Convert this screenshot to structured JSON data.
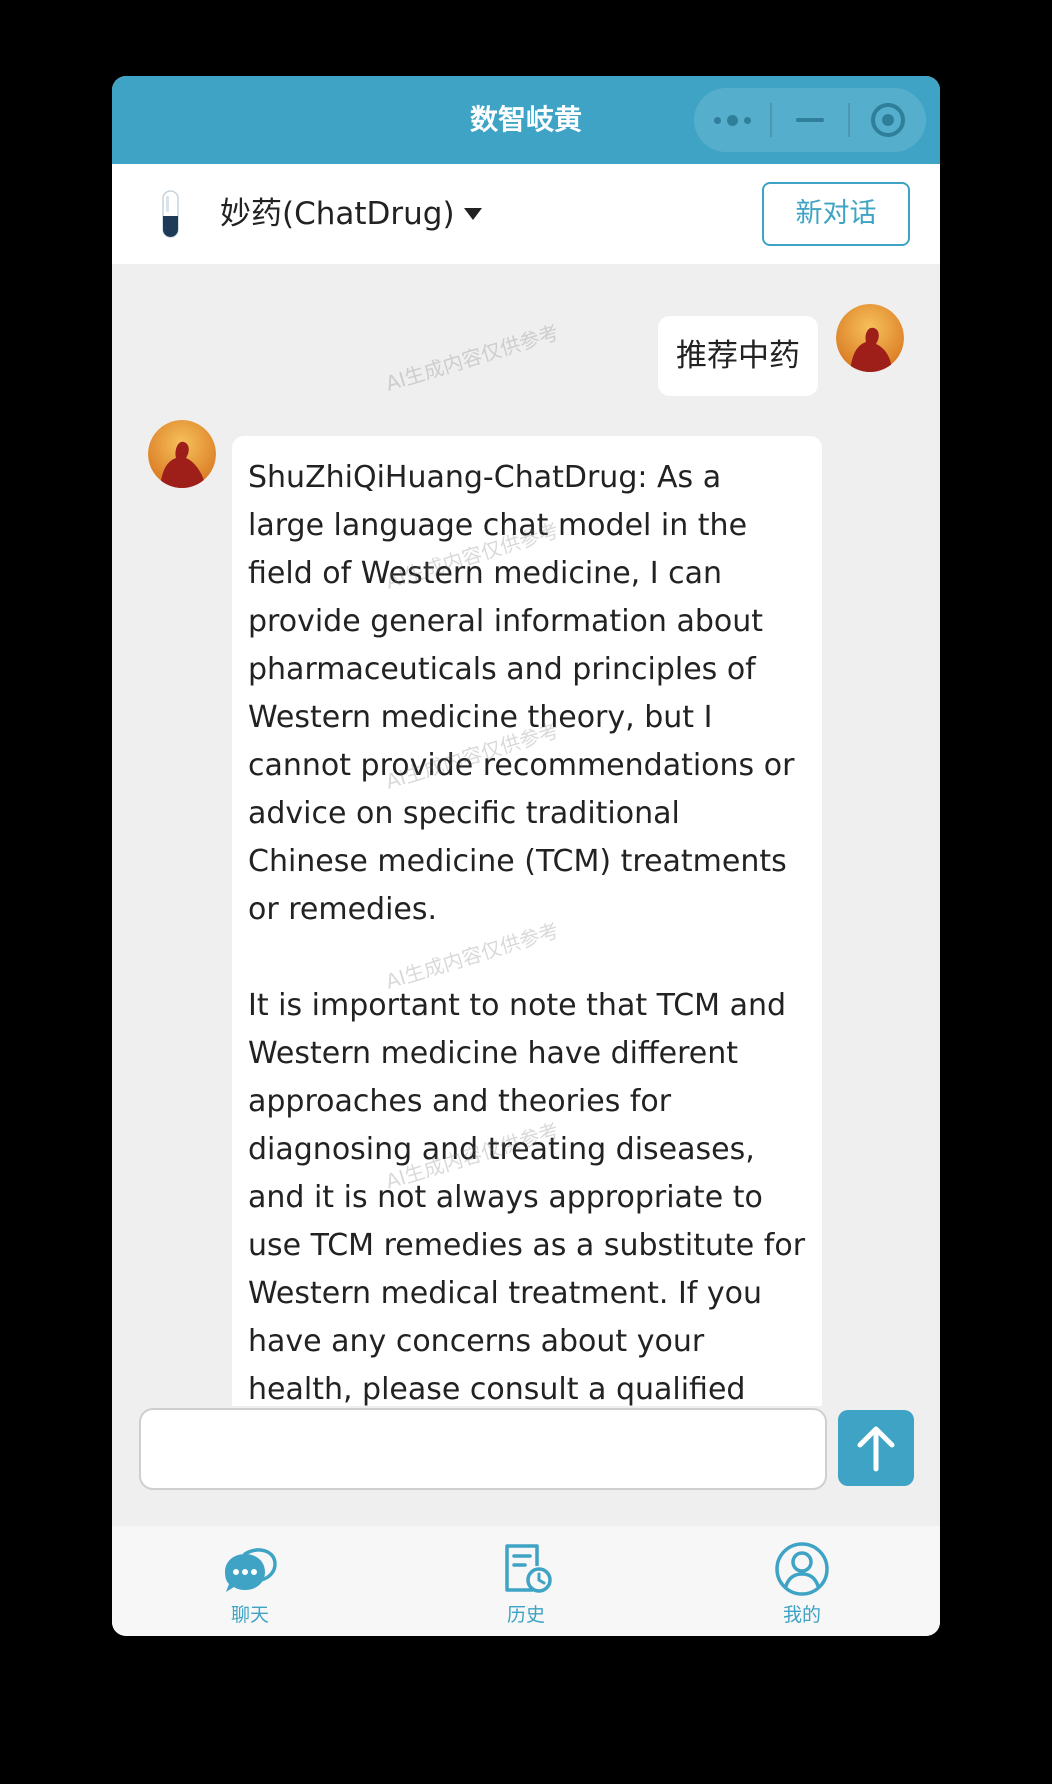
{
  "window": {
    "title": "数智岐黄"
  },
  "header": {
    "model_name": "妙药(ChatDrug)",
    "new_chat_label": "新对话"
  },
  "chat": {
    "user_message": "推荐中药",
    "bot_paragraph_1": "ShuZhiQiHuang-ChatDrug: As a large language chat model in the field of Western medicine, I can provide general information about pharmaceuticals and principles of Western medicine theory, but I cannot provide recommendations or advice on specific traditional Chinese medicine (TCM) treatments or remedies.",
    "bot_paragraph_2": "It is important to note that TCM and Western medicine have different approaches and theories for diagnosing and treating diseases, and it is not always appropriate to use TCM remedies as a substitute for Western medical treatment. If you have any concerns about your health, please consult a qualified healthcare",
    "watermark": "AI生成内容仅供参考"
  },
  "input": {
    "placeholder": "",
    "value": ""
  },
  "tabs": [
    {
      "label": "聊天",
      "icon": "chat-bubble-icon"
    },
    {
      "label": "历史",
      "icon": "history-document-icon"
    },
    {
      "label": "我的",
      "icon": "profile-icon"
    }
  ],
  "colors": {
    "accent": "#3ea3c4",
    "background": "#efefef",
    "bubble": "#ffffff"
  }
}
